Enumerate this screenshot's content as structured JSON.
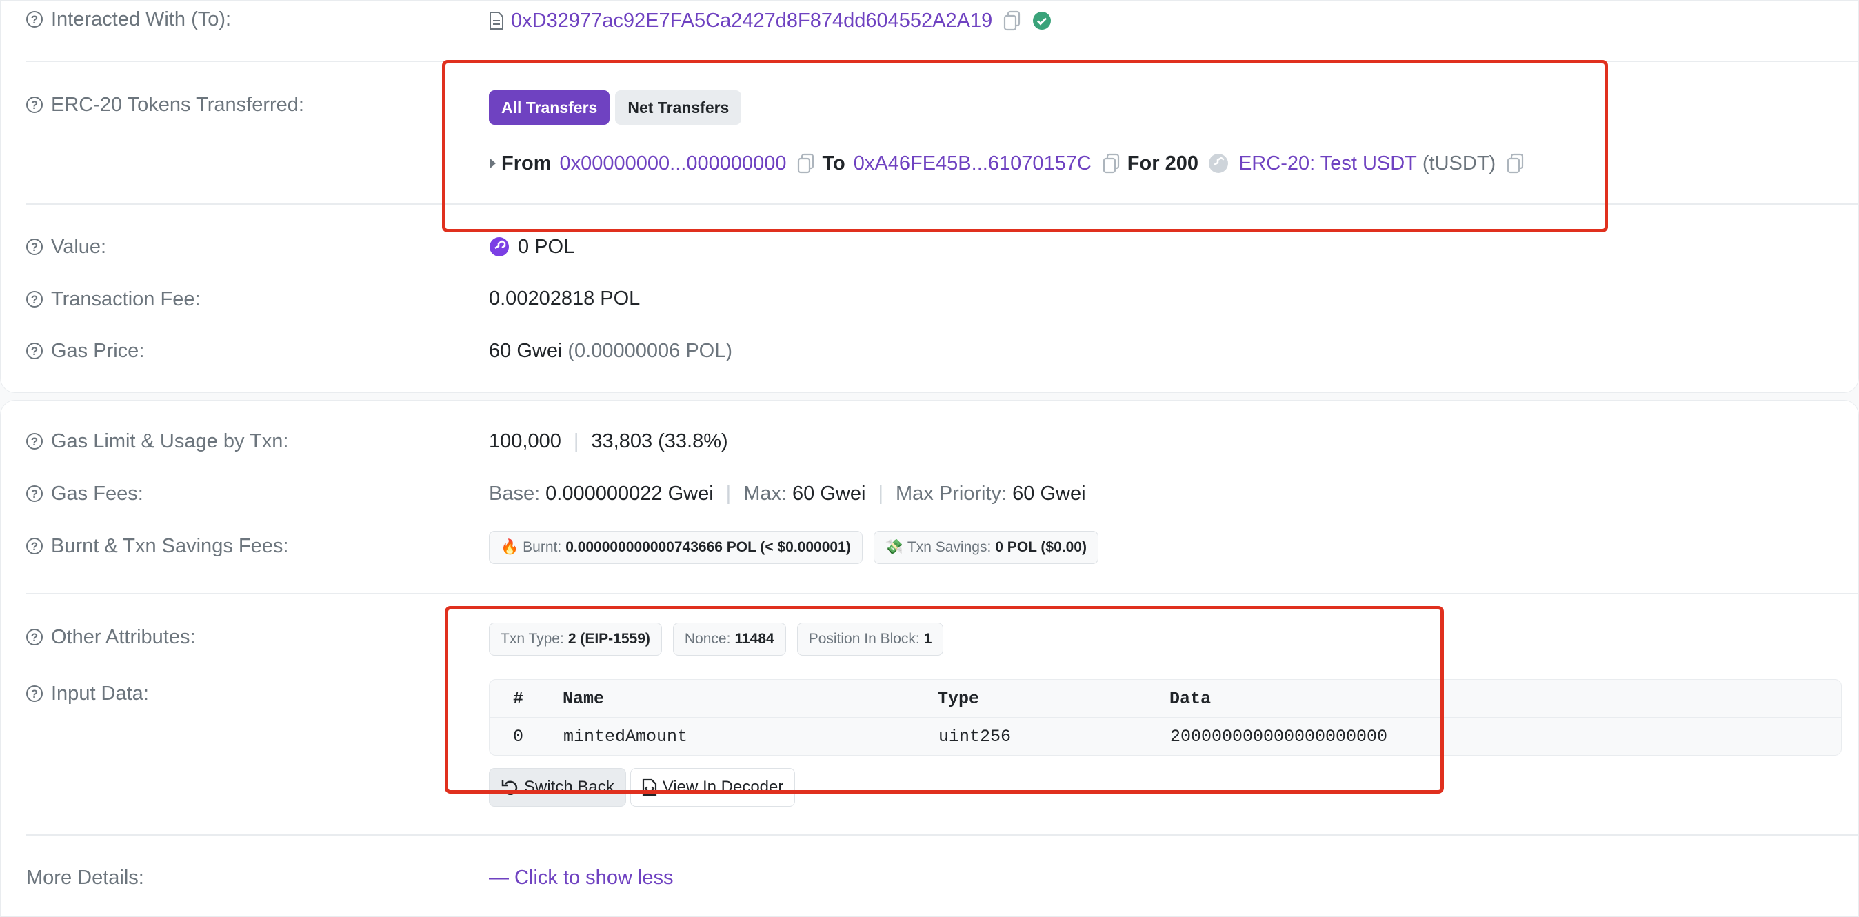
{
  "rows": {
    "interacted_with": {
      "label": "Interacted With (To):",
      "address": "0xD32977ac92E7FA5Ca2427d8F874dd604552A2A19"
    },
    "erc20": {
      "label": "ERC-20 Tokens Transferred:",
      "tab_all": "All Transfers",
      "tab_net": "Net Transfers",
      "from_label": "From",
      "from_addr": "0x00000000...000000000",
      "to_label": "To",
      "to_addr": "0xA46FE45B...61070157C",
      "for_label": "For 200",
      "token_name": "ERC-20: Test USDT",
      "token_symbol": "(tUSDT)"
    },
    "value": {
      "label": "Value:",
      "text": "0 POL"
    },
    "txn_fee": {
      "label": "Transaction Fee:",
      "text": "0.00202818 POL"
    },
    "gas_price": {
      "label": "Gas Price:",
      "main": "60 Gwei",
      "sub": "(0.00000006 POL)"
    },
    "gas_limit": {
      "label": "Gas Limit & Usage by Txn:",
      "limit": "100,000",
      "usage": "33,803 (33.8%)"
    },
    "gas_fees": {
      "label": "Gas Fees:",
      "base_label": "Base:",
      "base_value": "0.000000022 Gwei",
      "max_label": "Max:",
      "max_value": "60 Gwei",
      "priority_label": "Max Priority:",
      "priority_value": "60 Gwei"
    },
    "burnt": {
      "label": "Burnt & Txn Savings Fees:",
      "burnt_label": "Burnt:",
      "burnt_value": "0.000000000000743666 POL (< $0.000001)",
      "savings_label": "Txn Savings:",
      "savings_value": "0 POL ($0.00)"
    },
    "other_attrs": {
      "label": "Other Attributes:",
      "txn_type_label": "Txn Type:",
      "txn_type_value": "2 (EIP-1559)",
      "nonce_label": "Nonce:",
      "nonce_value": "11484",
      "position_label": "Position In Block:",
      "position_value": "1"
    },
    "input_data": {
      "label": "Input Data:",
      "columns": [
        "#",
        "Name",
        "Type",
        "Data"
      ],
      "row": [
        "0",
        "mintedAmount",
        "uint256",
        "200000000000000000000"
      ],
      "switch_back": "Switch Back",
      "view_decoder": "View In Decoder"
    },
    "more_details": {
      "label": "More Details:",
      "link": "— Click to show less"
    }
  },
  "colors": {
    "accent": "#6f42c1",
    "highlight_box": "#e0301e",
    "verified": "#3aa37a"
  }
}
